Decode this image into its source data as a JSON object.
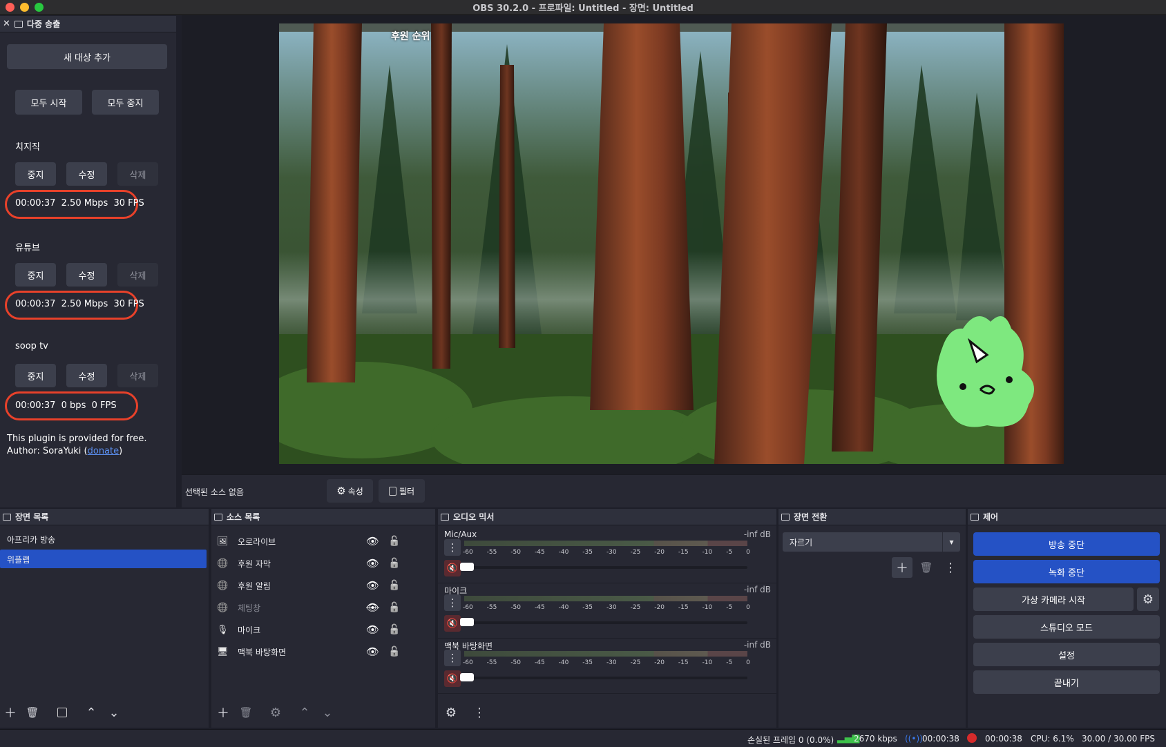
{
  "window": {
    "title": "OBS 30.2.0 - 프로파일: Untitled - 장면: Untitled"
  },
  "multistream": {
    "header": "다중 송출",
    "add_target": "새 대상 추가",
    "start_all": "모두 시작",
    "stop_all": "모두 중지",
    "targets": [
      {
        "name": "치지직",
        "stop": "중지",
        "edit": "수정",
        "delete": "삭제",
        "time": "00:00:37",
        "bitrate": "2.50 Mbps",
        "fps": "30 FPS"
      },
      {
        "name": "유튜브",
        "stop": "중지",
        "edit": "수정",
        "delete": "삭제",
        "time": "00:00:37",
        "bitrate": "2.50 Mbps",
        "fps": "30 FPS"
      },
      {
        "name": "soop tv",
        "stop": "중지",
        "edit": "수정",
        "delete": "삭제",
        "time": "00:00:37",
        "bitrate": "0 bps",
        "fps": "0 FPS"
      }
    ],
    "footer_line1": "This plugin is provided for free.",
    "footer_author": "Author: SoraYuki (",
    "footer_link": "donate",
    "footer_close": ")"
  },
  "preview": {
    "overlay_text": "후원 순위"
  },
  "propbar": {
    "no_source": "선택된 소스 없음",
    "properties": "속성",
    "filters": "필터"
  },
  "scenes": {
    "header": "장면 목록",
    "items": [
      "아프리카 방송",
      "위플랩"
    ],
    "selected_index": 1
  },
  "sources": {
    "header": "소스 목록",
    "items": [
      {
        "name": "오로라이브",
        "icon": "image-icon",
        "visible": true
      },
      {
        "name": "후원 자막",
        "icon": "globe-icon",
        "visible": true
      },
      {
        "name": "후원 알림",
        "icon": "globe-icon",
        "visible": true
      },
      {
        "name": "체팅창",
        "icon": "globe-icon",
        "visible": false
      },
      {
        "name": "마이크",
        "icon": "microphone-icon",
        "visible": true
      },
      {
        "name": "맥북 바탕화면",
        "icon": "monitor-icon",
        "visible": true
      }
    ]
  },
  "mixer": {
    "header": "오디오 믹서",
    "ticks": [
      "-60",
      "-55",
      "-50",
      "-45",
      "-40",
      "-35",
      "-30",
      "-25",
      "-20",
      "-15",
      "-10",
      "-5",
      "0"
    ],
    "channels": [
      {
        "name": "Mic/Aux",
        "level": "-inf dB"
      },
      {
        "name": "마이크",
        "level": "-inf dB"
      },
      {
        "name": "맥북 바탕화면",
        "level": "-inf dB"
      }
    ]
  },
  "transitions": {
    "header": "장면 전환",
    "selected": "자르기"
  },
  "controls": {
    "header": "제어",
    "stop_stream": "방송 중단",
    "stop_record": "녹화 중단",
    "virtual_cam": "가상 카메라 시작",
    "studio_mode": "스튜디오 모드",
    "settings": "설정",
    "exit": "끝내기"
  },
  "status": {
    "dropped": "손실된 프레임 0 (0.0%)",
    "bitrate": "2670 kbps",
    "stream_time": "00:00:38",
    "record_time": "00:00:38",
    "cpu": "CPU: 6.1%",
    "fps": "30.00 / 30.00 FPS"
  },
  "colors": {
    "accent": "#2552c5",
    "highlight_oval": "#e8412a",
    "dock_bg": "#272833"
  }
}
